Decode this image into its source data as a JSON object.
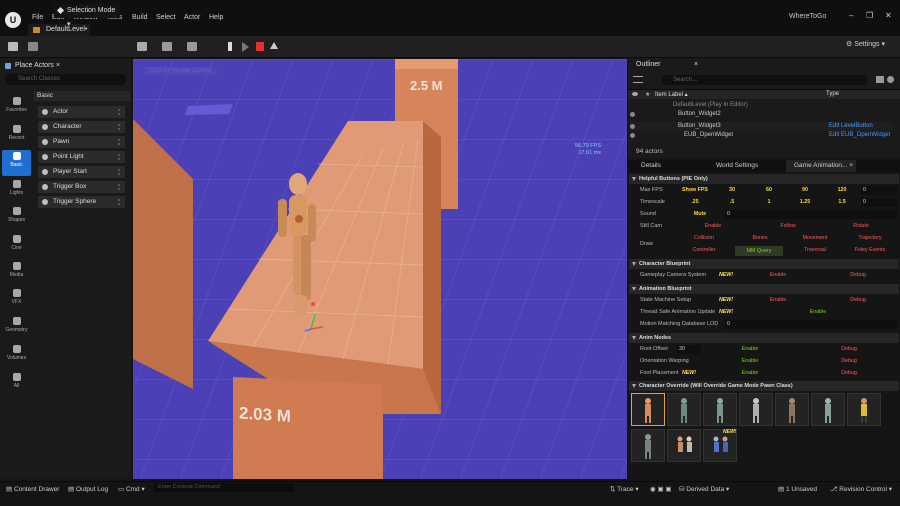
{
  "app": {
    "logo": "U",
    "menu": [
      "File",
      "Edit",
      "Window",
      "Tools",
      "Build",
      "Select",
      "Actor",
      "Help"
    ],
    "level_tab": "DefaultLevel•",
    "project": "WhereToGo",
    "window_controls": [
      "–",
      "❐",
      "✕"
    ]
  },
  "toolbar": {
    "selection_mode": "Selection Mode",
    "settings": "Settings"
  },
  "place_actors": {
    "title": "Place Actors",
    "close": "×",
    "search_placeholder": "Search Classes",
    "categories": [
      "Favorites",
      "Recent",
      "Basic",
      "Lights",
      "Shapes",
      "Cine",
      "Media",
      "VFX",
      "Geometry",
      "Volumes",
      "All"
    ],
    "active_category": "Basic",
    "section": "Basic",
    "items": [
      "Actor",
      "Character",
      "Pawn",
      "Point Light",
      "Player Start",
      "Trigger Box",
      "Trigger Sphere"
    ]
  },
  "viewport": {
    "overlay": "Click for Mouse Control",
    "fps": "56.79 FPS",
    "ms": "17.61 ms",
    "sign_top": "2.5 M",
    "sign_bottom": "2.03 M"
  },
  "outliner": {
    "title": "Outliner",
    "close": "×",
    "search_placeholder": "Search...",
    "col_label": "Item Label ▴",
    "col_type": "Type",
    "rows": [
      {
        "label": "DefaultLevel (Play In Editor)",
        "type": ""
      },
      {
        "label": "Button_Widget2",
        "type": ""
      },
      {
        "label": "Button_Widget3",
        "type": "Edit LevelButton"
      },
      {
        "label": "EUB_OpenWidget",
        "type": "Edit EUB_OpenWidget"
      }
    ],
    "actor_count": "94 actors"
  },
  "details_tabs": [
    "Details",
    "World Settings",
    "Game Animation..."
  ],
  "helpful": {
    "header": "Helpful Buttons (PIE Only)",
    "max_fps_label": "Max FPS",
    "max_fps": [
      "Show FPS",
      "30",
      "60",
      "90",
      "120"
    ],
    "max_fps_value": "0",
    "timescale_label": "Timescale",
    "timescale": [
      ".25",
      ".5",
      "1",
      "1.25",
      "1.5"
    ],
    "timescale_value": "0",
    "sound_label": "Sound",
    "sound_btn": "Mute",
    "sound_value": "0",
    "stillcam_label": "Still Cam",
    "stillcam": [
      "Enable",
      "Follow",
      "Rotate"
    ],
    "draw_label": "Draw",
    "draw_row1": [
      "Collision",
      "Bones",
      "Movement",
      "Trajectory"
    ],
    "draw_row2": [
      "Controller",
      "MM Query",
      "Traversal",
      "Foley Events"
    ]
  },
  "char_bp": {
    "header": "Character Blueprint",
    "label": "Gameplay Camera System",
    "new": "NEW!",
    "enable": "Enable",
    "debug": "Debug"
  },
  "anim_bp": {
    "header": "Animation Blueprint",
    "state_label": "State Machine Setup",
    "state_new": "NEW!",
    "state_enable": "Enable",
    "state_debug": "Debug",
    "thread_label": "Thread Safe Animation Update",
    "thread_new": "NEW!",
    "thread_enable": "Enable",
    "mm_label": "Motion Matching Database LOD",
    "mm_value": "0"
  },
  "anim_nodes": {
    "header": "Anim Nodes",
    "root_label": "Root Offset",
    "root_value": "30",
    "root_enable": "Enable",
    "root_debug": "Debug",
    "orient_label": "Orientation Warping",
    "orient_enable": "Enable",
    "orient_debug": "Debug",
    "foot_label": "Foot Placement",
    "foot_new": "NEW!",
    "foot_enable": "Enable",
    "foot_debug": "Debug"
  },
  "char_override": {
    "header": "Character Override (Will Override Game Mode Pawn Class)",
    "new": "NEW!",
    "count": 11
  },
  "statusbar": {
    "content_drawer": "Content Drawer",
    "output_log": "Output Log",
    "cmd": "Cmd ▾",
    "console_placeholder": "Enter Console Command",
    "trace": "Trace ▾",
    "derived": "Derived Data ▾",
    "unsaved": "1 Unsaved",
    "revision": "Revision Control ▾"
  },
  "colors": {
    "accent": "#1f6fd1",
    "viewport_floor": "#4b40b5",
    "platform": "#d07a4e",
    "link": "#4a9bff",
    "new": "#ffe24a",
    "debug": "#ff5a5a",
    "enable": "#7ed321"
  }
}
